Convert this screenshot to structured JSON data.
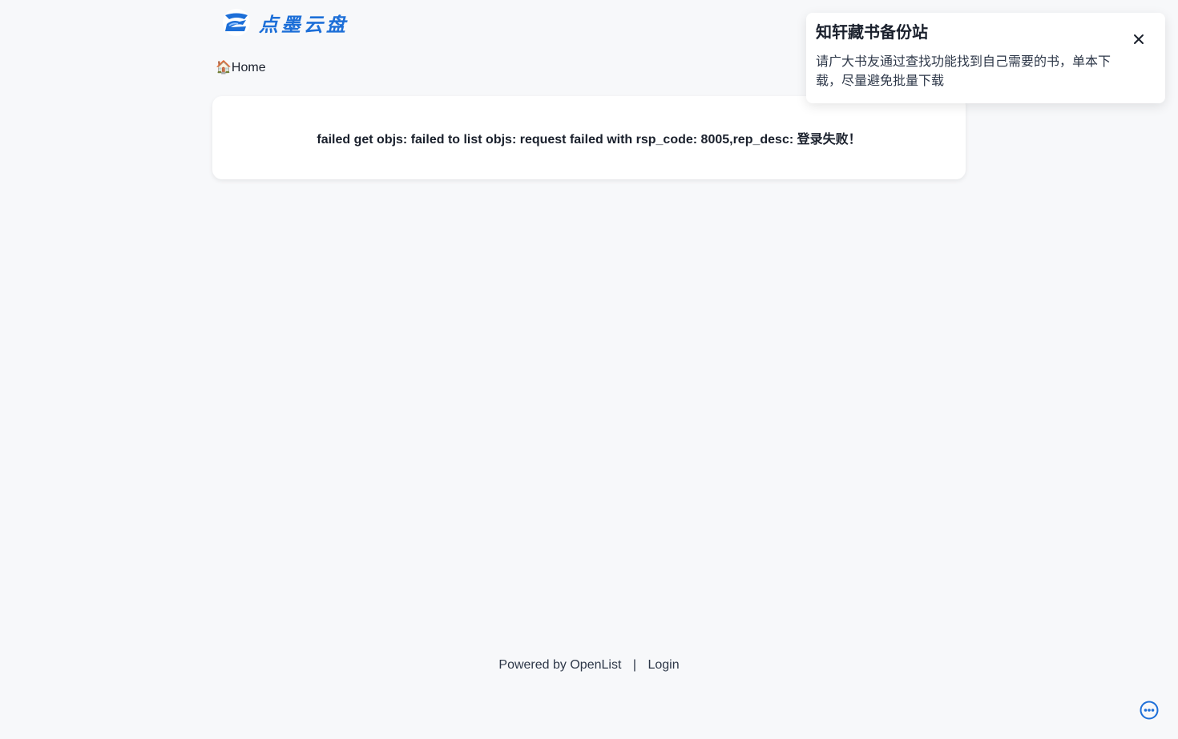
{
  "header": {
    "logo_text": "点墨云盘",
    "brand_color": "#1d6fd8"
  },
  "breadcrumb": {
    "home_icon": "🏠",
    "home_label": "Home"
  },
  "error": {
    "message": "failed get objs: failed to list objs: request failed with rsp_code: 8005,rep_desc: 登录失败！"
  },
  "notice": {
    "title": "知轩藏书备份站",
    "body": "请广大书友通过查找功能找到自己需要的书，单本下载，尽量避免批量下载",
    "close_icon": "close-icon"
  },
  "footer": {
    "powered_by": "Powered by",
    "openlist_label": "OpenList",
    "separator": "|",
    "login_label": "Login"
  },
  "floating": {
    "more_icon": "more-icon",
    "accent_color": "#1d6fd8"
  }
}
